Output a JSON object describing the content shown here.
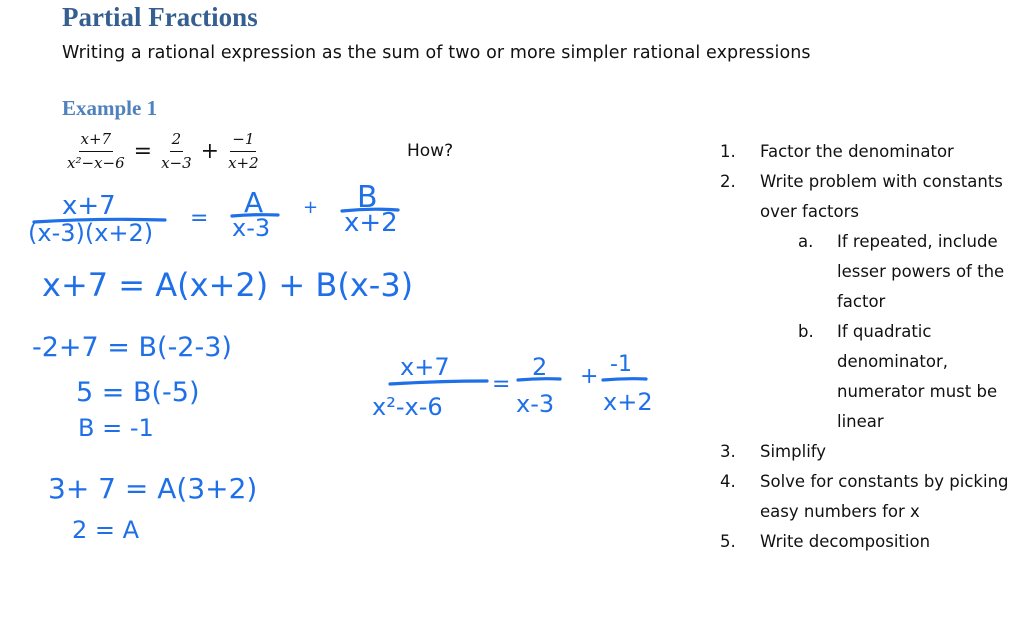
{
  "document": {
    "title": "Partial Fractions",
    "subtitle": "Writing a rational expression as the sum of two or more simpler rational expressions",
    "example_heading": "Example 1",
    "typed_equation": {
      "lhs": {
        "numerator": "x+7",
        "denominator": "x²−x−6"
      },
      "equals": "=",
      "term1": {
        "numerator": "2",
        "denominator": "x−3"
      },
      "plus": "+",
      "term2": {
        "numerator": "−1",
        "denominator": "x+2"
      }
    },
    "how_label": "How?"
  },
  "steps": [
    {
      "marker": "1.",
      "text": "Factor the denominator"
    },
    {
      "marker": "2.",
      "text": "Write problem with constants",
      "continuation": "over factors"
    },
    {
      "marker": "a.",
      "lines": [
        "If repeated, include",
        "lesser powers of the",
        "factor"
      ]
    },
    {
      "marker": "b.",
      "lines": [
        "If quadratic",
        "denominator,",
        "numerator must be",
        "linear"
      ]
    },
    {
      "marker": "3.",
      "text": "Simplify"
    },
    {
      "marker": "4.",
      "text": "Solve for constants by picking",
      "continuation": "easy numbers for x"
    },
    {
      "marker": "5.",
      "text": "Write decomposition"
    }
  ],
  "handwriting": {
    "ink_color": "#1E6FE8",
    "line1": {
      "num": "x+7",
      "den": "(x-3)(x+2)",
      "eq": "=",
      "t1num": "A",
      "t1den": "x-3",
      "plus": "+",
      "t2num": "B",
      "t2den": "x+2"
    },
    "line2": "x+7 = A(x+2) + B(x-3)",
    "line3": "-2+7 = B(-2-3)",
    "line4": "5 = B(-5)",
    "line5": "B = -1",
    "line6": "3+ 7 = A(3+2)",
    "line7": "2 = A",
    "result": {
      "num": "x+7",
      "den": "x²-x-6",
      "eq": "=",
      "t1num": "2",
      "t1den": "x-3",
      "plus": "+",
      "t2num": "-1",
      "t2den": "x+2"
    }
  },
  "colors": {
    "title": "#365F91",
    "heading": "#4F81BD",
    "ink": "#1E6FE8"
  }
}
